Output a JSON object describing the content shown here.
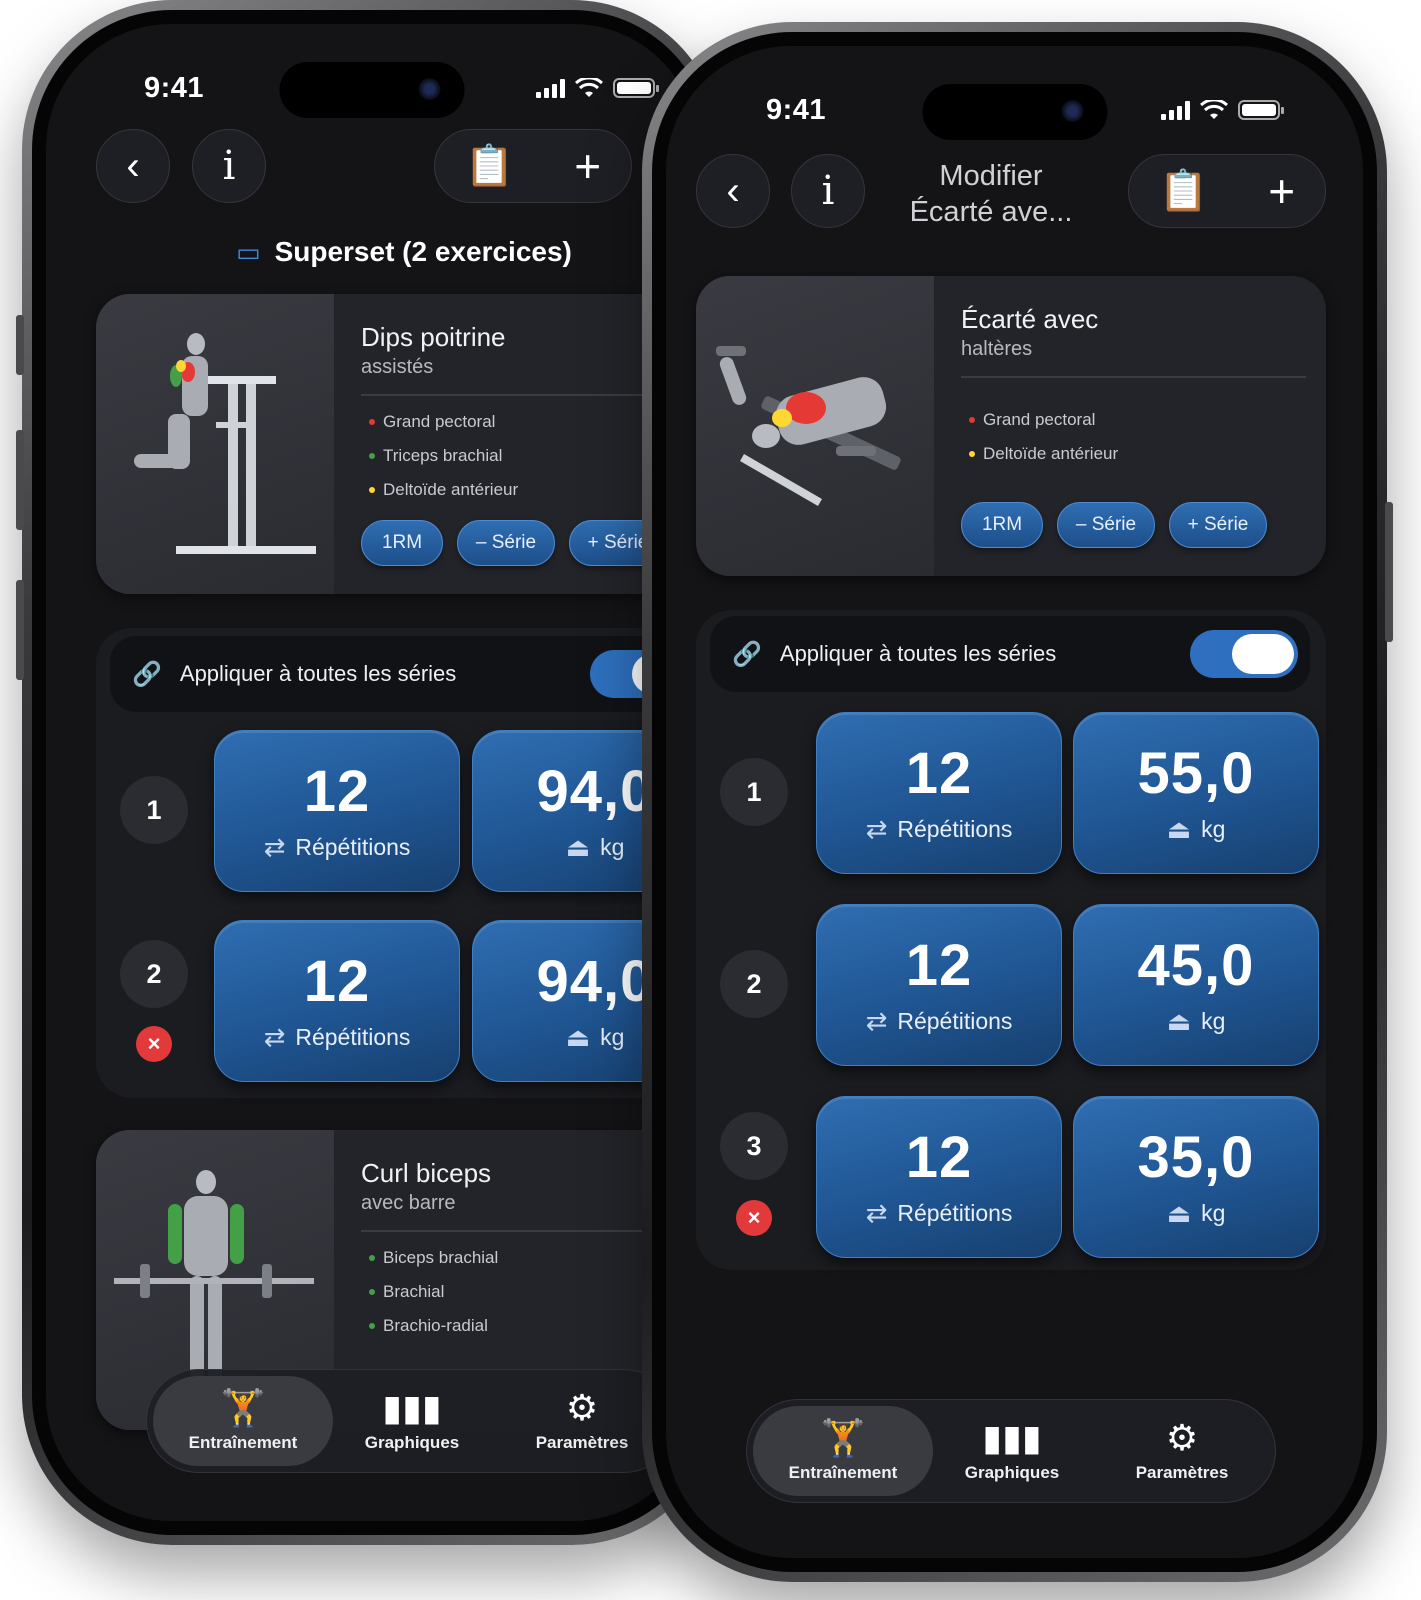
{
  "left": {
    "status": {
      "time": "9:41"
    },
    "header": {
      "back_icon": "chevron-left",
      "info_icon": "info",
      "notes_icon": "clipboard-edit",
      "add_icon": "plus"
    },
    "superset_title": "Superset (2 exercices)",
    "exercise1": {
      "title": "Dips poitrine",
      "subtitle": "assistés",
      "muscles": [
        {
          "label": "Grand pectoral",
          "color": "#e53935"
        },
        {
          "label": "Triceps brachial",
          "color": "#43a047"
        },
        {
          "label": "Deltoïde antérieur",
          "color": "#fdd835"
        }
      ],
      "chips": [
        "1RM",
        "– Série",
        "+ Série"
      ]
    },
    "apply_all": {
      "label": "Appliquer à toutes les séries",
      "enabled": true
    },
    "sets": [
      {
        "num": "1",
        "reps": "12",
        "reps_label": "Répétitions",
        "weight": "94,0",
        "unit": "kg"
      },
      {
        "num": "2",
        "reps": "12",
        "reps_label": "Répétitions",
        "weight": "94,0",
        "unit": "kg"
      }
    ],
    "exercise2": {
      "title": "Curl biceps",
      "subtitle": "avec barre",
      "muscles": [
        {
          "label": "Biceps brachial",
          "color": "#43a047"
        },
        {
          "label": "Brachial",
          "color": "#43a047"
        },
        {
          "label": "Brachio-radial",
          "color": "#43a047"
        }
      ]
    },
    "tabs": [
      {
        "label": "Entraînement",
        "icon": "weightlifter-icon",
        "active": true
      },
      {
        "label": "Graphiques",
        "icon": "bar-chart-icon",
        "active": false
      },
      {
        "label": "Paramètres",
        "icon": "gear-icon",
        "active": false
      }
    ]
  },
  "right": {
    "status": {
      "time": "9:41"
    },
    "header": {
      "title_line1": "Modifier",
      "title_line2": "Écarté ave..."
    },
    "exercise": {
      "title": "Écarté avec",
      "subtitle": "haltères",
      "muscles": [
        {
          "label": "Grand pectoral",
          "color": "#e53935"
        },
        {
          "label": "Deltoïde antérieur",
          "color": "#fdd835"
        }
      ],
      "chips": [
        "1RM",
        "– Série",
        "+ Série"
      ]
    },
    "apply_all": {
      "label": "Appliquer à toutes les séries",
      "enabled": true
    },
    "sets": [
      {
        "num": "1",
        "reps": "12",
        "reps_label": "Répétitions",
        "weight": "55,0",
        "unit": "kg"
      },
      {
        "num": "2",
        "reps": "12",
        "reps_label": "Répétitions",
        "weight": "45,0",
        "unit": "kg"
      },
      {
        "num": "3",
        "reps": "12",
        "reps_label": "Répétitions",
        "weight": "35,0",
        "unit": "kg"
      }
    ],
    "tabs": [
      {
        "label": "Entraînement",
        "icon": "weightlifter-icon",
        "active": true
      },
      {
        "label": "Graphiques",
        "icon": "bar-chart-icon",
        "active": false
      },
      {
        "label": "Paramètres",
        "icon": "gear-icon",
        "active": false
      }
    ]
  },
  "colors": {
    "accent": "#2e70bf",
    "delete": "#e23a3a",
    "background": "#141417"
  }
}
